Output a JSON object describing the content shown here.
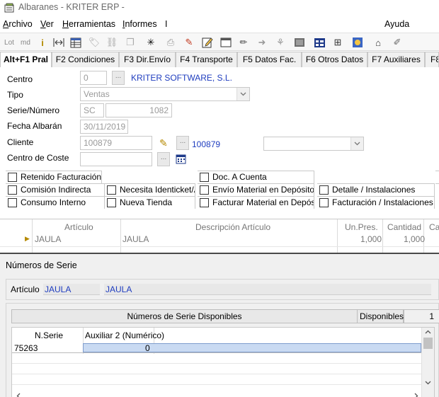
{
  "window": {
    "title": "Albaranes - KRITER ERP -"
  },
  "menu": {
    "items": [
      {
        "label": "Archivo",
        "ul": "A",
        "rest": "rchivo"
      },
      {
        "label": "Ver",
        "ul": "V",
        "rest": "er"
      },
      {
        "label": "Herramientas",
        "ul": "H",
        "rest": "erramientas"
      },
      {
        "label": "Informes",
        "ul": "I",
        "rest": "nformes"
      },
      {
        "label": "I"
      }
    ],
    "help": "Ayuda"
  },
  "toolbar": {
    "buttons": [
      "lot-icon",
      "md-icon",
      "info-icon",
      "fit-icon",
      "grid-icon",
      "tag-icon",
      "link-icon",
      "copy-icon",
      "sparkle-icon",
      "print-icon",
      "wrench-icon",
      "edit-icon",
      "window-icon",
      "clean-icon",
      "arrow-icon",
      "tree-icon",
      "image-icon",
      "table-icon",
      "branch-icon",
      "picture-icon",
      "tag2-icon",
      "notes-icon"
    ],
    "lot_label": "Lot",
    "md_label": "md"
  },
  "tabs": [
    {
      "label": "Alt+F1 Pral",
      "active": true
    },
    {
      "label": "F2 Condiciones"
    },
    {
      "label": "F3 Dir.Envío"
    },
    {
      "label": "F4 Transporte"
    },
    {
      "label": "F5 Datos Fac."
    },
    {
      "label": "F6 Otros Datos"
    },
    {
      "label": "F7 Auxiliares"
    },
    {
      "label": "F8"
    }
  ],
  "form": {
    "centro": {
      "label": "Centro",
      "value": "0",
      "name": "KRITER SOFTWARE, S.L."
    },
    "tipo": {
      "label": "Tipo",
      "value": "Ventas"
    },
    "serie_numero": {
      "label": "Serie/Número",
      "serie": "SC",
      "numero": "1082"
    },
    "fecha": {
      "label": "Fecha Albarán",
      "value": "30/11/2019"
    },
    "cliente": {
      "label": "Cliente",
      "value": "100879",
      "link": "100879",
      "combo_value": ""
    },
    "centro_coste": {
      "label": "Centro de Coste",
      "value": ""
    },
    "dots": "..."
  },
  "checks": [
    {
      "label": "Retenido Facturación",
      "checked": false
    },
    {
      "label": "Doc. A Cuenta",
      "checked": false
    },
    {
      "label": "Comisión Indirecta",
      "checked": false
    },
    {
      "label": "Necesita Identicket/A",
      "checked": false
    },
    {
      "label": "Envío Material en Depósito",
      "checked": false
    },
    {
      "label": "Detalle / Instalaciones",
      "checked": false
    },
    {
      "label": "Consumo Interno",
      "checked": false
    },
    {
      "label": "Nueva Tienda",
      "checked": false
    },
    {
      "label": "Facturar Material en Depósito",
      "checked": false
    },
    {
      "label": "Facturación / Instalaciones",
      "checked": false
    }
  ],
  "lines_grid": {
    "headers": [
      "Artículo",
      "Descripción Artículo",
      "Un.Pres.",
      "Cantidad",
      "Ca"
    ],
    "rows": [
      {
        "articulo": "JAULA",
        "descripcion": "JAULA",
        "un_pres": "1,000",
        "cantidad": "1,000"
      }
    ]
  },
  "serie_dialog": {
    "title": "Números de Serie",
    "articulo_label": "Artículo",
    "articulo_code": "JAULA",
    "articulo_desc": "JAULA",
    "available_header": "Números de Serie Disponibles",
    "disponibles_label": "Disponibles",
    "disponibles_count": "1",
    "grid_headers": [
      "N.Serie",
      "Auxiliar 2 (Numérico)"
    ],
    "rows": [
      {
        "serie": "75263",
        "aux2": "0"
      }
    ]
  }
}
